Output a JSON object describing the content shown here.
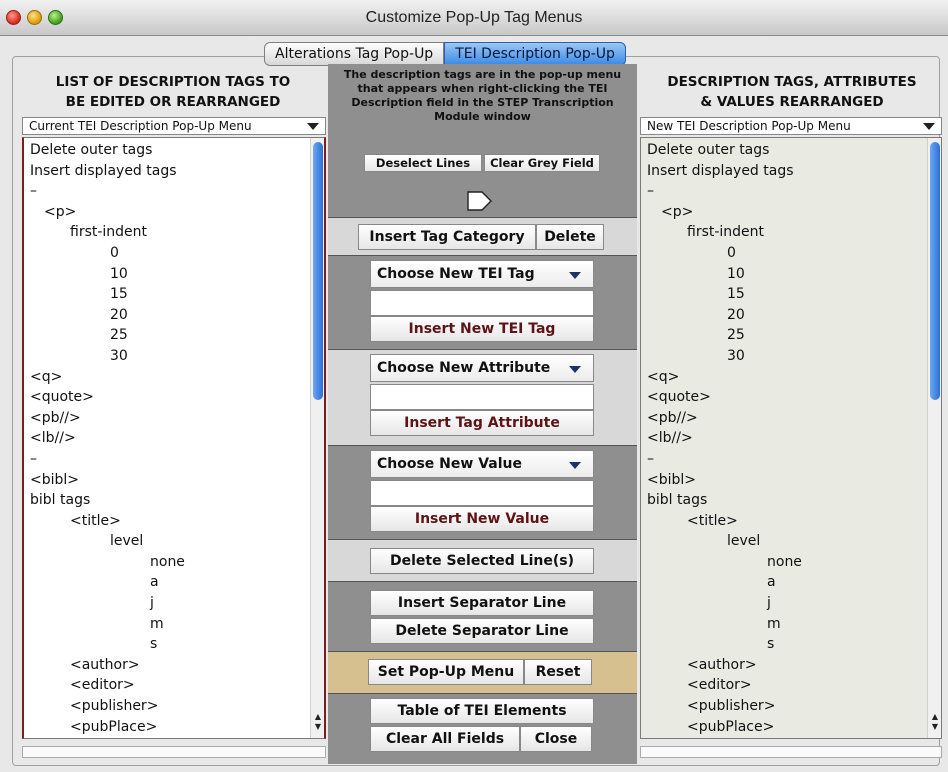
{
  "window": {
    "title": "Customize Pop-Up Tag Menus"
  },
  "tabs": [
    {
      "label": "Alterations Tag Pop-Up",
      "active": false
    },
    {
      "label": "TEI Description Pop-Up",
      "active": true
    }
  ],
  "left": {
    "header_line1": "LIST OF DESCRIPTION TAGS TO",
    "header_line2": "BE EDITED OR REARRANGED",
    "menu_label": "Current TEI Description Pop-Up Menu"
  },
  "right": {
    "header_line1": "DESCRIPTION TAGS, ATTRIBUTES",
    "header_line2": "& VALUES REARRANGED",
    "menu_label": "New TEI Description Pop-Up Menu"
  },
  "list_items": [
    {
      "text": "Delete outer tags",
      "indent": 0
    },
    {
      "text": "Insert displayed tags",
      "indent": 0
    },
    {
      "text": "–",
      "indent": 0
    },
    {
      "text": "<p>",
      "indent": 1
    },
    {
      "text": "first-indent",
      "indent": 2
    },
    {
      "text": "0",
      "indent": 3
    },
    {
      "text": "10",
      "indent": 3
    },
    {
      "text": "15",
      "indent": 3
    },
    {
      "text": "20",
      "indent": 3
    },
    {
      "text": "25",
      "indent": 3
    },
    {
      "text": "30",
      "indent": 3
    },
    {
      "text": "<q>",
      "indent": 0
    },
    {
      "text": "<quote>",
      "indent": 0
    },
    {
      "text": "<pb//>",
      "indent": 0
    },
    {
      "text": "<lb//>",
      "indent": 0
    },
    {
      "text": "–",
      "indent": 0
    },
    {
      "text": "<bibl>",
      "indent": 0
    },
    {
      "text": "bibl tags",
      "indent": 0
    },
    {
      "text": "<title>",
      "indent": 2
    },
    {
      "text": "level",
      "indent": 4
    },
    {
      "text": "none",
      "indent": 5
    },
    {
      "text": "a",
      "indent": 5
    },
    {
      "text": "j",
      "indent": 5
    },
    {
      "text": "m",
      "indent": 5
    },
    {
      "text": "s",
      "indent": 5
    },
    {
      "text": "<author>",
      "indent": 2
    },
    {
      "text": "<editor>",
      "indent": 2
    },
    {
      "text": "<publisher>",
      "indent": 2
    },
    {
      "text": "<pubPlace>",
      "indent": 2
    }
  ],
  "middle": {
    "info_text": "The description tags are in the pop-up menu that appears when right-clicking the TEI Description field in the STEP Transcription Module window",
    "deselect_lines": "Deselect Lines",
    "clear_grey_field": "Clear Grey Field",
    "insert_tag_category": "Insert Tag Category",
    "delete": "Delete",
    "choose_new_tei_tag": "Choose New TEI Tag",
    "tei_tag_value": "",
    "insert_new_tei_tag": "Insert New TEI Tag",
    "choose_new_attribute": "Choose New Attribute",
    "attribute_value": "",
    "insert_tag_attribute": "Insert Tag Attribute",
    "choose_new_value": "Choose New Value",
    "value_value": "",
    "insert_new_value": "Insert New Value",
    "delete_selected_lines": "Delete Selected Line(s)",
    "insert_separator_line": "Insert Separator Line",
    "delete_separator_line": "Delete Separator Line",
    "set_popup_menu": "Set Pop-Up Menu",
    "reset": "Reset",
    "table_of_tei_elements": "Table of TEI Elements",
    "clear_all_fields": "Clear All Fields",
    "close": "Close"
  },
  "colors": {
    "active_tab": "#3a8ae6",
    "scroll_thumb": "#2a6fd8",
    "dark_section": "#8f8f8f",
    "light_section": "#d8d8d8",
    "tan_section": "#d6c08f",
    "insert_button_text": "#5e1414"
  }
}
